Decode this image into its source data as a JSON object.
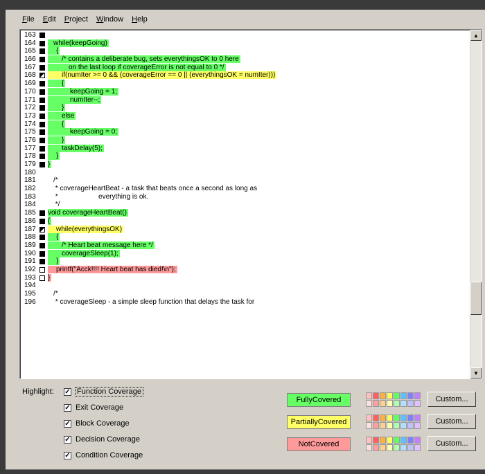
{
  "menu": [
    {
      "label": "File",
      "key": "F",
      "rest": "ile"
    },
    {
      "label": "Edit",
      "key": "E",
      "rest": "dit"
    },
    {
      "label": "Project",
      "key": "P",
      "rest": "roject"
    },
    {
      "label": "Window",
      "key": "W",
      "rest": "indow"
    },
    {
      "label": "Help",
      "key": "H",
      "rest": "elp"
    }
  ],
  "code_lines": [
    {
      "num": "163",
      "marker": "full",
      "text": "",
      "hl": "",
      "indent": 0
    },
    {
      "num": "164",
      "marker": "full",
      "text": "while(keepGoing)",
      "hl": "full",
      "indent": 8
    },
    {
      "num": "165",
      "marker": "full",
      "text": "{",
      "hl": "full",
      "indent": 12
    },
    {
      "num": "166",
      "marker": "full",
      "text": "/* contains a deliberate bug, sets everythingsOK to 0 here",
      "hl": "full",
      "indent": 20
    },
    {
      "num": "167",
      "marker": "full",
      "text": "on the last loop if coverageError is not equal to 0 */",
      "hl": "full",
      "indent": 30
    },
    {
      "num": "168",
      "marker": "partial",
      "text": "if(numIter >= 0 && (coverageError == 0 || (everythingsOK = numIter)))",
      "hl": "part",
      "indent": 20
    },
    {
      "num": "169",
      "marker": "full",
      "text": "{",
      "hl": "full",
      "indent": 20
    },
    {
      "num": "170",
      "marker": "full",
      "text": "keepGoing = 1;",
      "hl": "full",
      "indent": 32
    },
    {
      "num": "171",
      "marker": "full",
      "text": "numIter--;",
      "hl": "full",
      "indent": 32
    },
    {
      "num": "172",
      "marker": "full",
      "text": "}",
      "hl": "full",
      "indent": 20
    },
    {
      "num": "173",
      "marker": "full",
      "text": "else",
      "hl": "full",
      "indent": 20
    },
    {
      "num": "174",
      "marker": "full",
      "text": "{",
      "hl": "full",
      "indent": 20
    },
    {
      "num": "175",
      "marker": "full",
      "text": "keepGoing = 0;",
      "hl": "full",
      "indent": 32
    },
    {
      "num": "176",
      "marker": "full",
      "text": "}",
      "hl": "full",
      "indent": 20
    },
    {
      "num": "177",
      "marker": "full",
      "text": "taskDelay(5);",
      "hl": "full",
      "indent": 20
    },
    {
      "num": "178",
      "marker": "full",
      "text": "}",
      "hl": "full",
      "indent": 12
    },
    {
      "num": "179",
      "marker": "full",
      "text": "}",
      "hl": "full",
      "indent": 0
    },
    {
      "num": "180",
      "marker": "",
      "text": "",
      "hl": "",
      "indent": 0
    },
    {
      "num": "181",
      "marker": "",
      "text": "/*",
      "hl": "",
      "indent": 0
    },
    {
      "num": "182",
      "marker": "",
      "text": " * coverageHeartBeat - a task that beats once a second as long as",
      "hl": "",
      "indent": 0
    },
    {
      "num": "183",
      "marker": "",
      "text": " *                     everything is ok.",
      "hl": "",
      "indent": 0
    },
    {
      "num": "184",
      "marker": "",
      "text": " */",
      "hl": "",
      "indent": 0
    },
    {
      "num": "185",
      "marker": "full",
      "text": "void coverageHeartBeat()",
      "hl": "full",
      "indent": 0
    },
    {
      "num": "186",
      "marker": "full",
      "text": "{",
      "hl": "full",
      "indent": 0
    },
    {
      "num": "187",
      "marker": "partial",
      "text": "while(everythingsOK)",
      "hl": "part",
      "indent": 12
    },
    {
      "num": "188",
      "marker": "full",
      "text": "{",
      "hl": "full",
      "indent": 12
    },
    {
      "num": "189",
      "marker": "full",
      "text": "/* Heart beat message here */",
      "hl": "full",
      "indent": 20
    },
    {
      "num": "190",
      "marker": "full",
      "text": "coverageSleep(1);",
      "hl": "full",
      "indent": 20
    },
    {
      "num": "191",
      "marker": "full",
      "text": "}",
      "hl": "full",
      "indent": 12
    },
    {
      "num": "192",
      "marker": "none",
      "text": "printf(\"Acck!!!! Heart beat has died!\\n\");",
      "hl": "none",
      "indent": 12
    },
    {
      "num": "193",
      "marker": "none",
      "text": "}",
      "hl": "none",
      "indent": 0
    },
    {
      "num": "194",
      "marker": "",
      "text": "",
      "hl": "",
      "indent": 0
    },
    {
      "num": "195",
      "marker": "",
      "text": "/*",
      "hl": "",
      "indent": 0
    },
    {
      "num": "196",
      "marker": "",
      "text": " * coverageSleep - a simple sleep function that delays the task for",
      "hl": "",
      "indent": 0
    }
  ],
  "panel": {
    "highlight_label": "Highlight:",
    "checkboxes": [
      {
        "label": "Function Coverage",
        "checked": true
      },
      {
        "label": "Exit Coverage",
        "checked": true
      },
      {
        "label": "Block Coverage",
        "checked": true
      },
      {
        "label": "Decision Coverage",
        "checked": true
      },
      {
        "label": "Condition Coverage",
        "checked": true
      }
    ],
    "legends": [
      {
        "label": "FullyCovered",
        "color": "#66ff66"
      },
      {
        "label": "PartiallyCovered",
        "color": "#ffff66"
      },
      {
        "label": "NotCovered",
        "color": "#ff9a9a"
      }
    ],
    "custom_label": "Custom...",
    "swatch_colors": [
      "#ffc0c0",
      "#ff6060",
      "#ffb040",
      "#ffff60",
      "#60ff60",
      "#60c0ff",
      "#8080ff",
      "#c080ff",
      "#ffe0e0",
      "#ffa0a0",
      "#ffd090",
      "#ffffb0",
      "#b0ffb0",
      "#b0e0ff",
      "#c0c0ff",
      "#e0c0ff"
    ]
  }
}
